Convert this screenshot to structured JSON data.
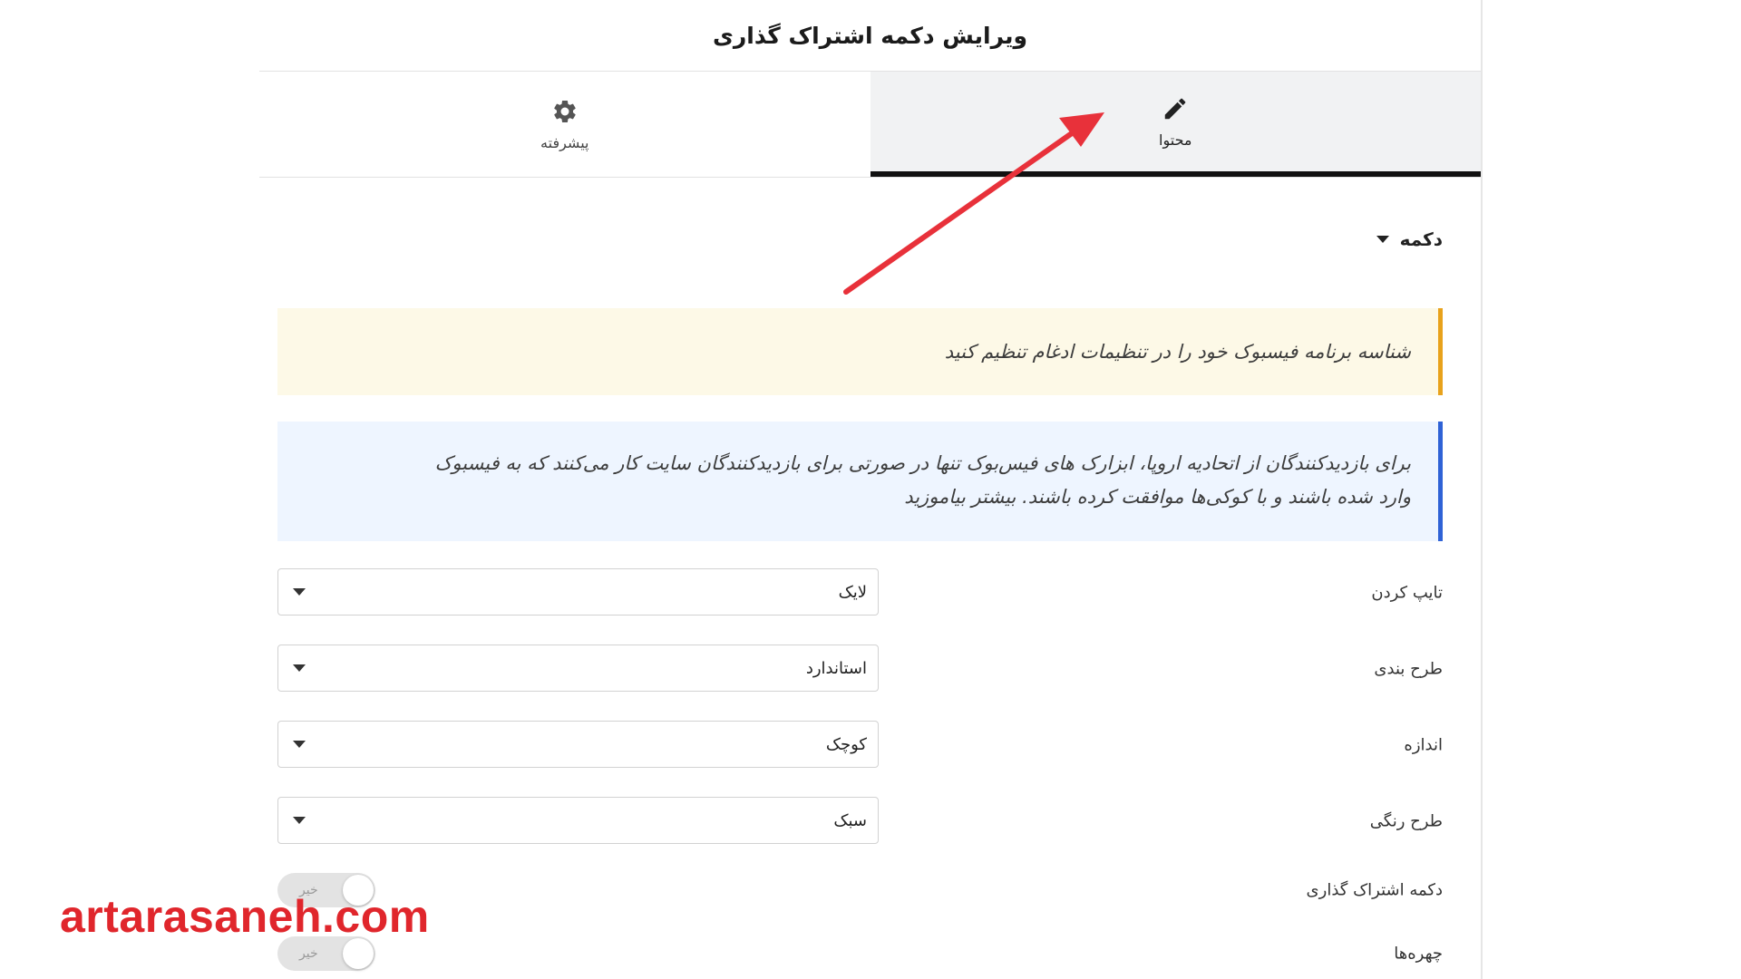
{
  "panel": {
    "title": "ویرایش دکمه اشتراک گذاری"
  },
  "tabs": [
    {
      "label": "محتوا",
      "icon": "pencil-icon",
      "active": true
    },
    {
      "label": "پیشرفته",
      "icon": "gear-icon",
      "active": false
    }
  ],
  "section": {
    "title": "دکمه"
  },
  "notices": {
    "warning": "شناسه برنامه فیسبوک خود را در تنظیمات ادغام تنظیم کنید",
    "info_line1": "برای بازدیدکنندگان از اتحادیه اروپا، ابزارک های فیس‌بوک تنها در صورتی برای بازدیدکنندگان سایت کار می‌کنند که به فیسبوک",
    "info_line2": "وارد شده باشند و با کوکی‌ها موافقت کرده باشند.",
    "info_link": "بیشتر بیاموزید"
  },
  "fields": {
    "type": {
      "label": "تایپ کردن",
      "value": "لایک"
    },
    "layout": {
      "label": "طرح بندی",
      "value": "استاندارد"
    },
    "size": {
      "label": "اندازه",
      "value": "کوچک"
    },
    "color": {
      "label": "طرح رنگی",
      "value": "سبک"
    },
    "share": {
      "label": "دکمه اشتراک گذاری",
      "toggle_text": "خیر"
    },
    "faces": {
      "label": "چهره‌ها",
      "toggle_text": "خیر"
    }
  },
  "watermark": "artarasaneh.com",
  "colors": {
    "accent_arrow": "#e8313a",
    "warning_border": "#e8a21c",
    "info_border": "#2f62d6",
    "watermark": "#e0262c"
  }
}
